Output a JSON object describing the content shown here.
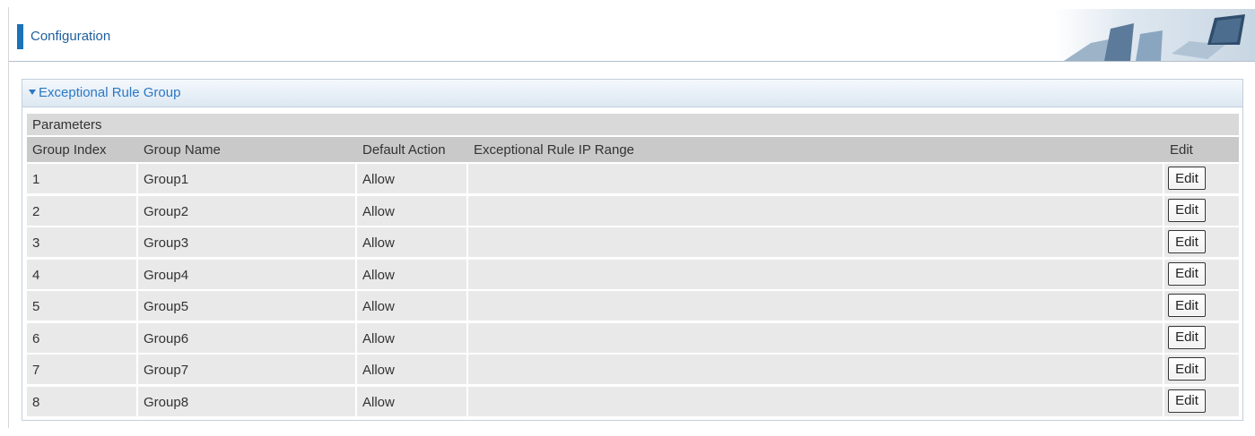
{
  "header": {
    "title": "Configuration"
  },
  "section": {
    "title": "Exceptional Rule Group",
    "params_label": "Parameters",
    "columns": {
      "group_index": "Group Index",
      "group_name": "Group Name",
      "default_action": "Default Action",
      "ip_range": "Exceptional Rule IP Range",
      "edit": "Edit"
    },
    "rows": [
      {
        "index": "1",
        "name": "Group1",
        "action": "Allow",
        "ip_range": "",
        "edit_label": "Edit"
      },
      {
        "index": "2",
        "name": "Group2",
        "action": "Allow",
        "ip_range": "",
        "edit_label": "Edit"
      },
      {
        "index": "3",
        "name": "Group3",
        "action": "Allow",
        "ip_range": "",
        "edit_label": "Edit"
      },
      {
        "index": "4",
        "name": "Group4",
        "action": "Allow",
        "ip_range": "",
        "edit_label": "Edit"
      },
      {
        "index": "5",
        "name": "Group5",
        "action": "Allow",
        "ip_range": "",
        "edit_label": "Edit"
      },
      {
        "index": "6",
        "name": "Group6",
        "action": "Allow",
        "ip_range": "",
        "edit_label": "Edit"
      },
      {
        "index": "7",
        "name": "Group7",
        "action": "Allow",
        "ip_range": "",
        "edit_label": "Edit"
      },
      {
        "index": "8",
        "name": "Group8",
        "action": "Allow",
        "ip_range": "",
        "edit_label": "Edit"
      }
    ]
  },
  "colors": {
    "accent": "#1a72b8",
    "section_title": "#2a78c6",
    "header_row": "#c9c9c9",
    "body_row": "#e9e9e9"
  }
}
